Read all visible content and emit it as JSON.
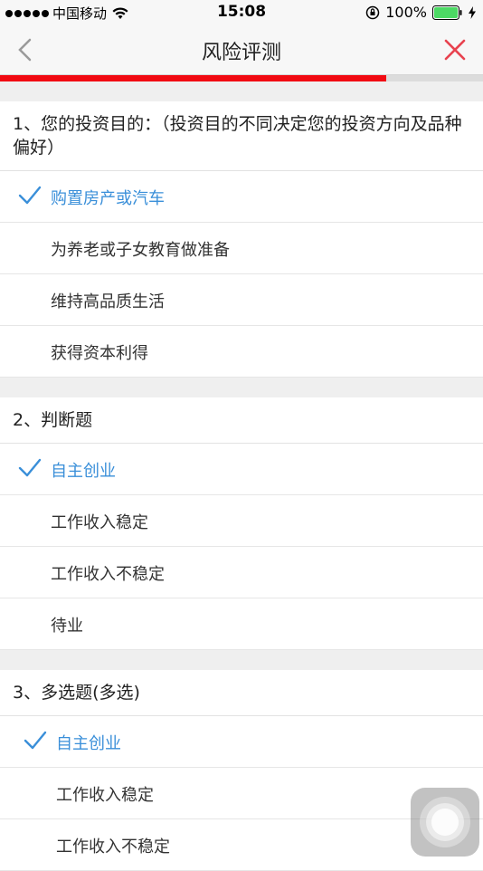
{
  "status_bar": {
    "carrier": "中国移动",
    "time": "15:08",
    "battery": "100%"
  },
  "nav": {
    "title": "风险评测"
  },
  "progress": {
    "fraction": 0.8
  },
  "questions": [
    {
      "text": "1、您的投资目的：（投资目的不同决定您的投资方向及品种偏好）",
      "options": [
        {
          "label": "购置房产或汽车",
          "selected": true
        },
        {
          "label": "为养老或子女教育做准备",
          "selected": false
        },
        {
          "label": "维持高品质生活",
          "selected": false
        },
        {
          "label": "获得资本利得",
          "selected": false
        }
      ]
    },
    {
      "text": "2、判断题",
      "options": [
        {
          "label": "自主创业",
          "selected": true
        },
        {
          "label": "工作收入稳定",
          "selected": false
        },
        {
          "label": "工作收入不稳定",
          "selected": false
        },
        {
          "label": "待业",
          "selected": false
        }
      ]
    },
    {
      "text": "3、多选题(多选)",
      "options": [
        {
          "label": "自主创业",
          "selected": true
        },
        {
          "label": "工作收入稳定",
          "selected": false
        },
        {
          "label": "工作收入不稳定",
          "selected": false
        }
      ]
    }
  ],
  "colors": {
    "accent": "#3a8fd9",
    "progress": "#f10a12",
    "close": "#e8424f"
  },
  "icons": {
    "back": "chevron-left-icon",
    "close": "close-icon",
    "check": "checkmark-icon",
    "wifi": "wifi-icon",
    "battery": "battery-icon",
    "lock": "rotation-lock-icon"
  }
}
